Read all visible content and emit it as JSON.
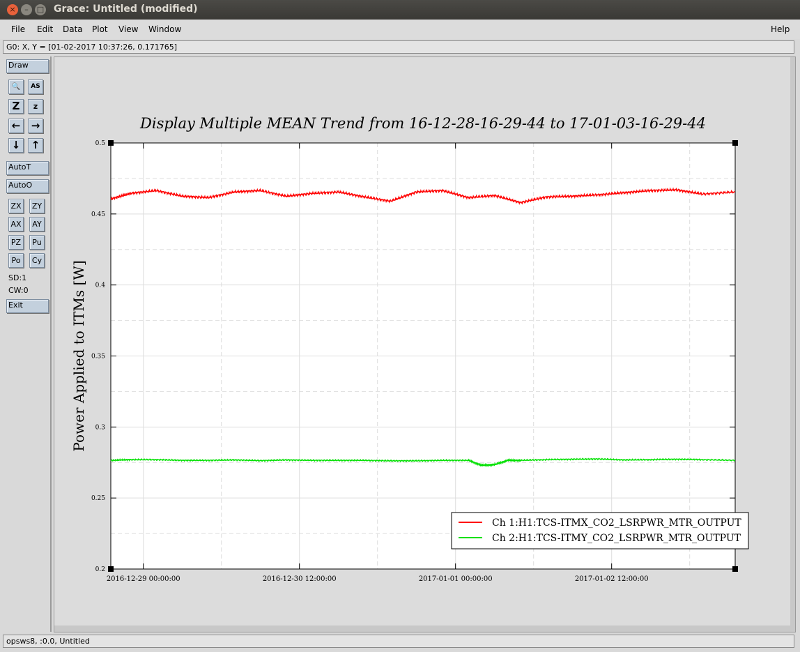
{
  "window": {
    "title": "Grace: Untitled (modified)",
    "close_glyph": "×",
    "minimize_glyph": "–",
    "maximize_glyph": "□"
  },
  "menubar": {
    "items": [
      "File",
      "Edit",
      "Data",
      "Plot",
      "View",
      "Window"
    ],
    "help": "Help"
  },
  "locator": "G0: X, Y = [01-02-2017 10:37:26, 0.171765]",
  "toolbar": {
    "draw": "Draw",
    "zoom_glyph": "🔍",
    "text_glyph": "AS",
    "zoom_x_big": "Z",
    "zoom_small": "z",
    "left_arrow": "←",
    "right_arrow": "→",
    "down_arrow": "↓",
    "up_arrow": "↑",
    "autot": "AutoT",
    "autoo": "AutoO",
    "zx": "ZX",
    "zy": "ZY",
    "ax": "AX",
    "ay": "AY",
    "pz": "PZ",
    "pu": "Pu",
    "po": "Po",
    "cy": "Cy",
    "sd": "SD:1",
    "cw": "CW:0",
    "exit": "Exit"
  },
  "status": "opsws8, :0.0, Untitled",
  "chart_data": {
    "type": "line",
    "title": "Display Multiple MEAN Trend from 16-12-28-16-29-44 to 17-01-03-16-29-44",
    "ylabel": "Power Applied to ITMs [W]",
    "xlabel": "",
    "ylim": [
      0.2,
      0.5
    ],
    "y_ticks": [
      "0.2",
      "0.25",
      "0.3",
      "0.35",
      "0.4",
      "0.45",
      "0.5"
    ],
    "xlim": [
      "2016-12-28 16:29:44",
      "2017-01-03 16:29:44"
    ],
    "x_ticks": [
      "2016-12-29 00:00:00",
      "2016-12-30 12:00:00",
      "2017-01-01 00:00:00",
      "2017-01-02 12:00:00"
    ],
    "grid": true,
    "legend_position": "bottom-right",
    "series": [
      {
        "name": "Ch 1:H1:TCS-ITMX_CO2_LSRPWR_MTR_OUTPUT",
        "color": "#ff0000",
        "x": [
          "2016-12-28 16:29:44",
          "2016-12-28 21:00:00",
          "2016-12-29 03:00:00",
          "2016-12-29 09:00:00",
          "2016-12-29 15:00:00",
          "2016-12-29 21:00:00",
          "2016-12-30 03:00:00",
          "2016-12-30 09:00:00",
          "2016-12-30 15:00:00",
          "2016-12-30 21:00:00",
          "2016-12-31 03:00:00",
          "2016-12-31 09:00:00",
          "2016-12-31 15:00:00",
          "2016-12-31 21:00:00",
          "2017-01-01 03:00:00",
          "2017-01-01 09:00:00",
          "2017-01-01 15:00:00",
          "2017-01-01 21:00:00",
          "2017-01-02 03:00:00",
          "2017-01-02 09:00:00",
          "2017-01-02 15:00:00",
          "2017-01-02 21:00:00",
          "2017-01-03 03:00:00",
          "2017-01-03 09:00:00",
          "2017-01-03 16:29:44"
        ],
        "y": [
          0.4605,
          0.4645,
          0.4665,
          0.4625,
          0.4615,
          0.4655,
          0.4665,
          0.4625,
          0.4645,
          0.4655,
          0.462,
          0.459,
          0.4655,
          0.4665,
          0.4615,
          0.463,
          0.458,
          0.462,
          0.4625,
          0.4635,
          0.465,
          0.4665,
          0.467,
          0.464,
          0.4655
        ]
      },
      {
        "name": "Ch 2:H1:TCS-ITMY_CO2_LSRPWR_MTR_OUTPUT",
        "color": "#00e000",
        "x": [
          "2016-12-28 16:29:44",
          "2016-12-28 21:00:00",
          "2016-12-29 03:00:00",
          "2016-12-29 09:00:00",
          "2016-12-29 15:00:00",
          "2016-12-29 21:00:00",
          "2016-12-30 03:00:00",
          "2016-12-30 09:00:00",
          "2016-12-30 15:00:00",
          "2016-12-30 21:00:00",
          "2016-12-31 03:00:00",
          "2016-12-31 09:00:00",
          "2016-12-31 15:00:00",
          "2016-12-31 21:00:00",
          "2017-01-01 03:00:00",
          "2017-01-01 06:00:00",
          "2017-01-01 09:00:00",
          "2017-01-01 12:00:00",
          "2017-01-01 15:00:00",
          "2017-01-01 21:00:00",
          "2017-01-02 03:00:00",
          "2017-01-02 09:00:00",
          "2017-01-02 15:00:00",
          "2017-01-02 21:00:00",
          "2017-01-03 03:00:00",
          "2017-01-03 09:00:00",
          "2017-01-03 16:29:44"
        ],
        "y": [
          0.2765,
          0.277,
          0.277,
          0.2765,
          0.2765,
          0.2768,
          0.2763,
          0.2768,
          0.2765,
          0.2765,
          0.2765,
          0.2762,
          0.2762,
          0.2765,
          0.2765,
          0.273,
          0.2735,
          0.2765,
          0.2765,
          0.277,
          0.2773,
          0.2775,
          0.2768,
          0.277,
          0.2773,
          0.277,
          0.2765
        ]
      }
    ]
  }
}
